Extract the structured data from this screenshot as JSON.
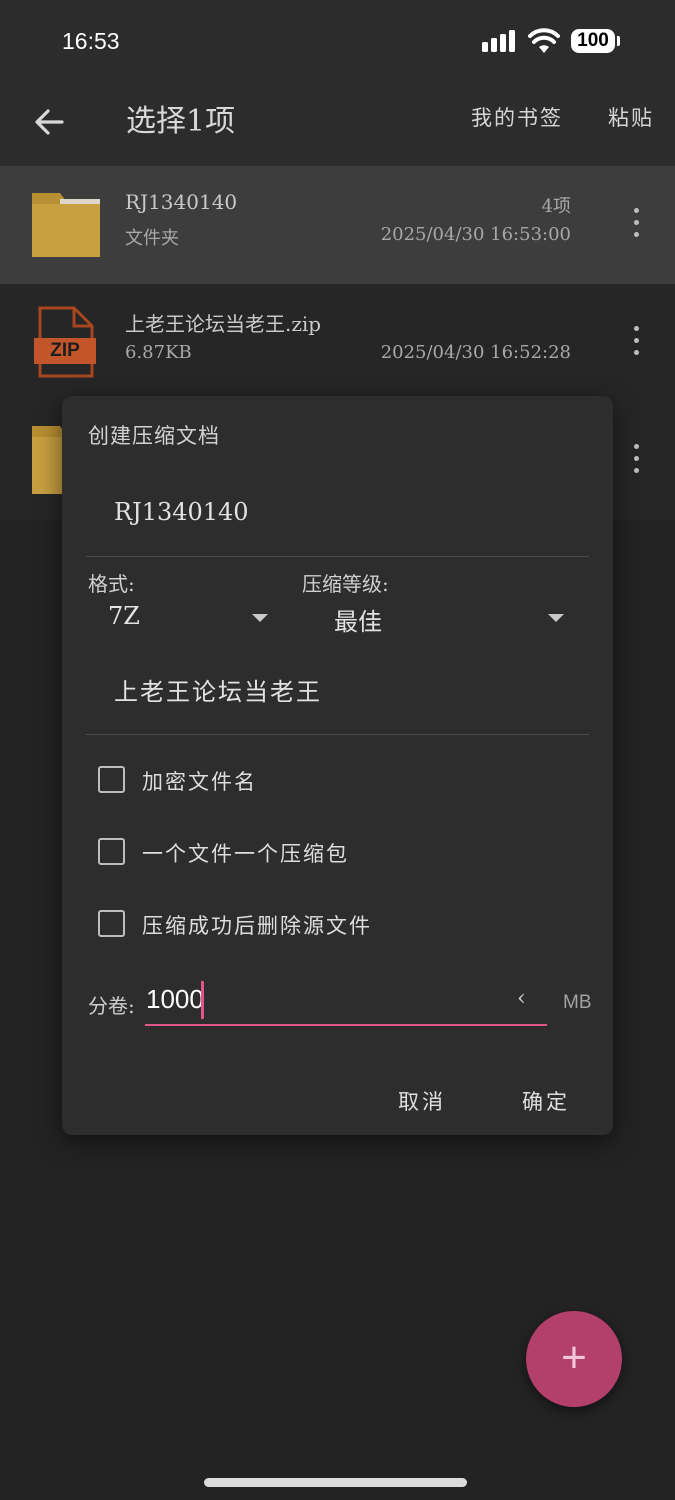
{
  "status_bar": {
    "time": "16:53",
    "battery": "100"
  },
  "app_bar": {
    "title": "选择1项",
    "bookmarks": "我的书签",
    "paste": "粘贴"
  },
  "files": [
    {
      "name": "RJ1340140",
      "subtitle": "文件夹",
      "count": "4项",
      "date": "2025/04/30  16:53:00",
      "icon": "folder-icon"
    },
    {
      "name": "上老王论坛当老王.zip",
      "subtitle": "6.87KB",
      "date": "2025/04/30  16:52:28",
      "icon": "zip-file-icon",
      "badge": "ZIP"
    },
    {
      "icon": "folder-icon"
    }
  ],
  "dialog": {
    "title": "创建压缩文档",
    "archive_name": "RJ1340140",
    "format_label": "格式:",
    "format_value": "7Z",
    "level_label": "压缩等级:",
    "level_value": "最佳",
    "subfolder_name": "上老王论坛当老王",
    "options": [
      {
        "label": "加密文件名",
        "checked": false
      },
      {
        "label": "一个文件一个压缩包",
        "checked": false
      },
      {
        "label": "压缩成功后删除源文件",
        "checked": false
      }
    ],
    "split_label": "分卷:",
    "split_value": "1000",
    "split_unit": "MB",
    "cancel": "取消",
    "confirm": "确定"
  },
  "fab": {
    "label": "+"
  },
  "colors": {
    "accent": "#e0558a",
    "fab": "#b33f6b",
    "folder": "#c9a040"
  }
}
